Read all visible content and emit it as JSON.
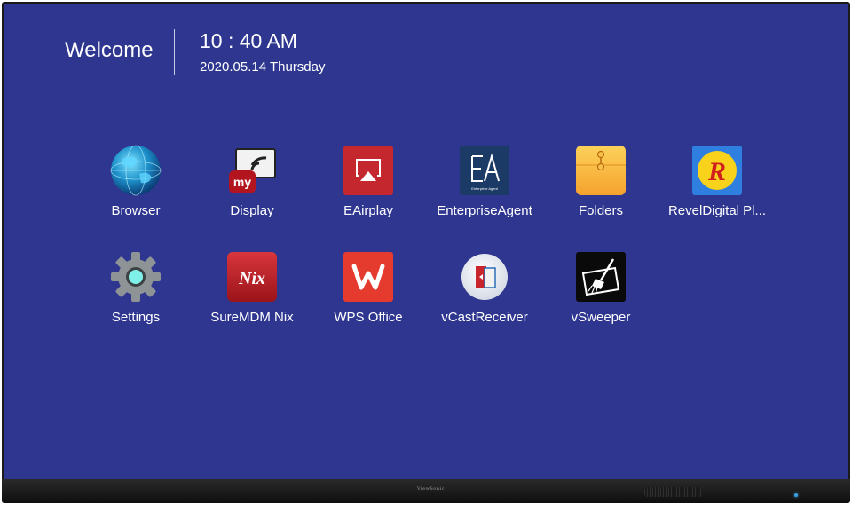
{
  "header": {
    "welcome": "Welcome",
    "time": "10 : 40 AM",
    "date": "2020.05.14 Thursday"
  },
  "bezel": {
    "brand": "ViewSonic"
  },
  "apps": [
    {
      "label": "Browser",
      "icon": "globe-icon"
    },
    {
      "label": "Display",
      "icon": "mydisplay-cast-icon"
    },
    {
      "label": "EAirplay",
      "icon": "airplay-icon"
    },
    {
      "label": "EnterpriseAgent",
      "icon": "enterprise-agent-icon"
    },
    {
      "label": "Folders",
      "icon": "folder-icon"
    },
    {
      "label": "RevelDigital Pl...",
      "icon": "revel-digital-icon"
    },
    {
      "label": "Settings",
      "icon": "gear-icon"
    },
    {
      "label": "SureMDM Nix",
      "icon": "nix-icon"
    },
    {
      "label": "WPS Office",
      "icon": "wps-icon"
    },
    {
      "label": "vCastReceiver",
      "icon": "vcast-icon"
    },
    {
      "label": "vSweeper",
      "icon": "sweeper-icon"
    }
  ],
  "icon_text": {
    "display_badge": "my",
    "enterprise_agent": "Enterprise Agent",
    "revel": "R",
    "nix": "Nix"
  },
  "colors": {
    "desktop_background": "#2e3690",
    "airplay_red": "#c4282e",
    "wps_red": "#e53a2e",
    "folder_yellow": "#f9b63c",
    "revel_blue": "#2f7fe0"
  }
}
